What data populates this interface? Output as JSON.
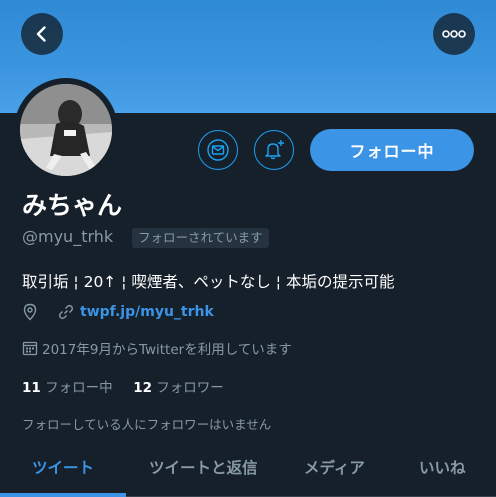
{
  "header": {
    "back_icon": "chevron-left-icon",
    "more_icon": "more-horizontal-icon",
    "banner_color": "#3c95df"
  },
  "profile": {
    "display_name": "みちゃん",
    "handle": "@myu_trhk",
    "follows_you_badge": "フォローされています",
    "bio": "取引垢 ¦ 20↑ ¦ 喫煙者、ペットなし ¦ 本垢の提示可能",
    "link": "twpf.jp/myu_trhk",
    "joined": "2017年9月からTwitterを利用しています",
    "following_count": "11",
    "following_label": "フォロー中",
    "followers_count": "12",
    "followers_label": "フォロワー",
    "mutual_note": "フォローしている人にフォロワーはいません"
  },
  "actions": {
    "message_icon": "mail-icon",
    "notify_icon": "bell-plus-icon",
    "follow_button_label": "フォロー中",
    "accent_color": "#3b94e6"
  },
  "tabs": [
    {
      "label": "ツイート",
      "active": true
    },
    {
      "label": "ツイートと返信",
      "active": false
    },
    {
      "label": "メディア",
      "active": false
    },
    {
      "label": "いいね",
      "active": false
    }
  ]
}
